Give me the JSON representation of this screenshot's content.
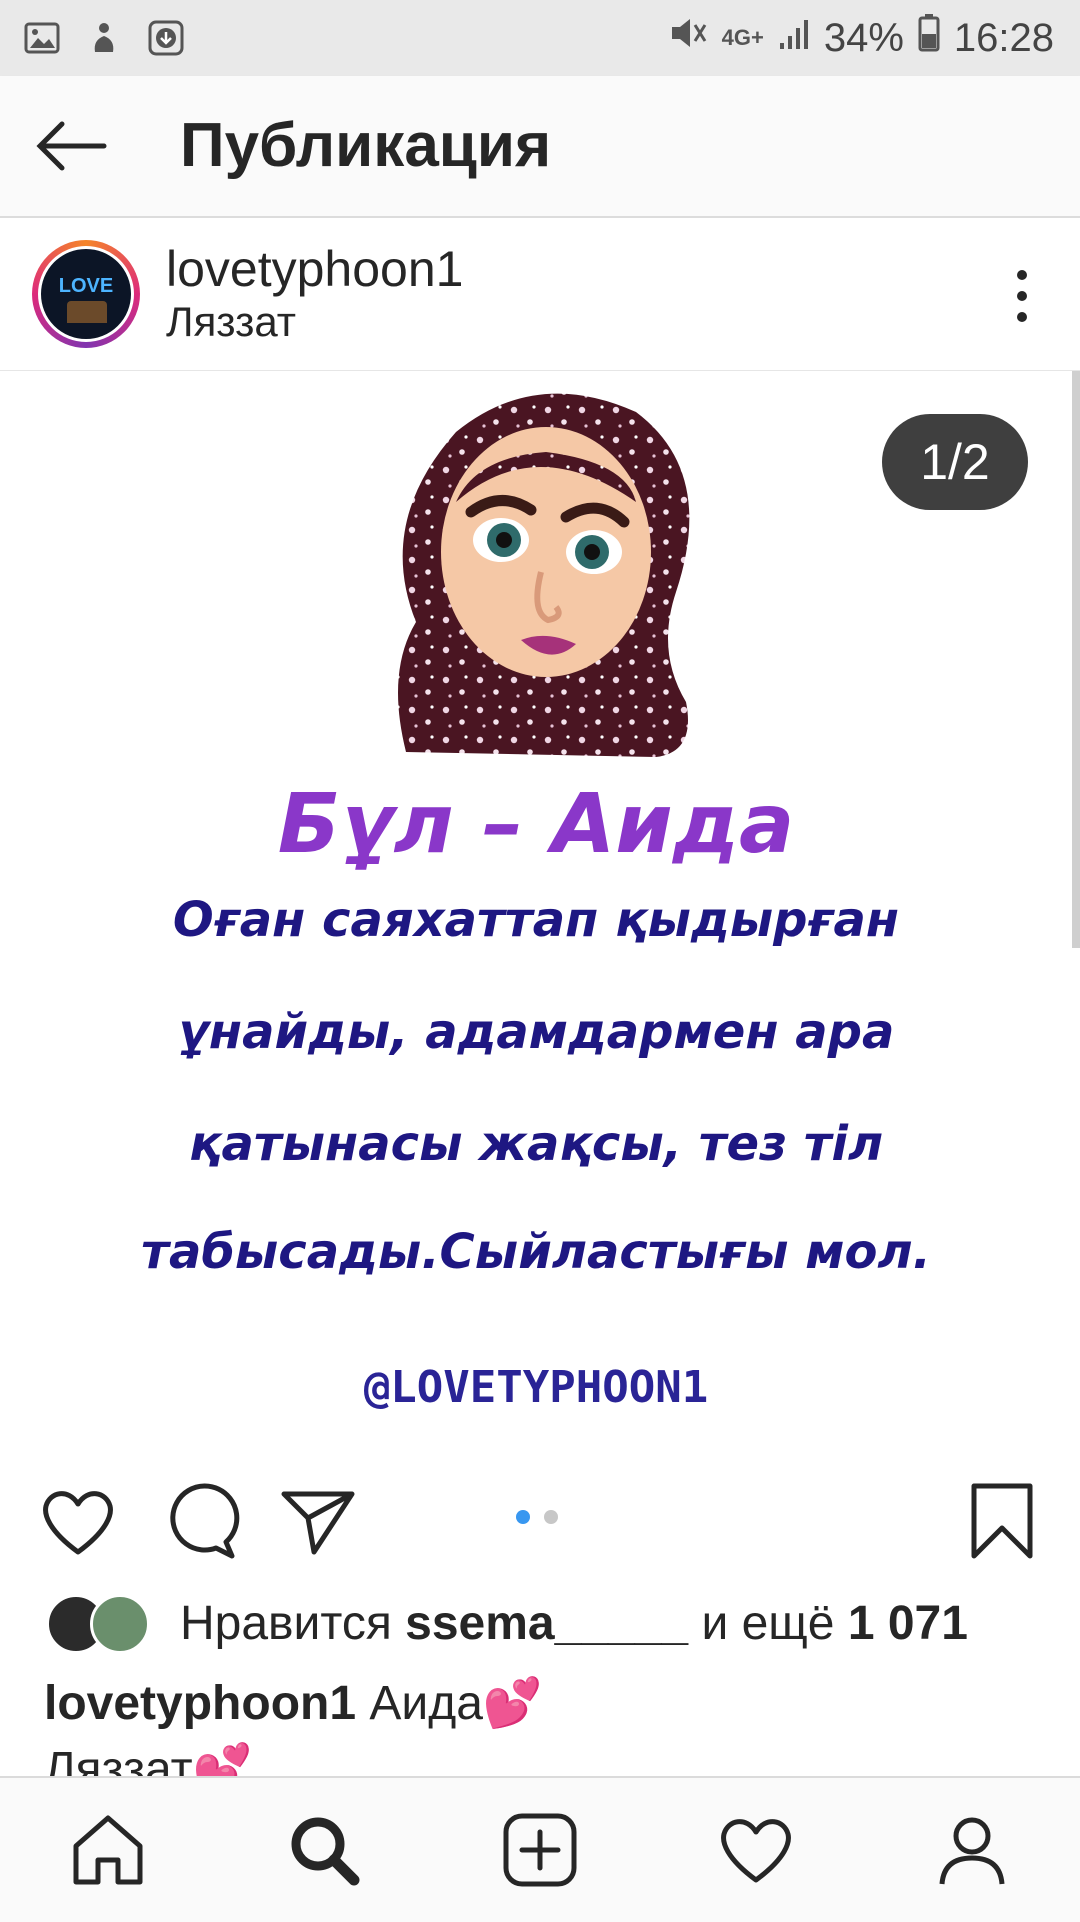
{
  "status_bar": {
    "network": "4G+",
    "battery": "34%",
    "time": "16:28"
  },
  "header": {
    "title": "Публикация"
  },
  "post": {
    "username": "lovetyphoon1",
    "location": "Ляззат",
    "avatar_text": "LOVE",
    "counter": "1/2",
    "image_text": {
      "title": "Бұл – Аида",
      "lines": [
        "Оған саяхаттап қыдырған",
        "ұнайды, адамдармен ара",
        "қатынасы жақсы, тез тіл",
        "табысады.Сыйластығы мол."
      ],
      "handle": "@LOVETYPHOON1"
    },
    "likes": {
      "prefix": "Нравится",
      "user": "ssema_____",
      "middle": "и ещё",
      "count": "1 071"
    },
    "caption": {
      "user": "lovetyphoon1",
      "text": "Аида💕",
      "second_line": "Ляззат💕"
    },
    "carousel": {
      "pages": 2,
      "active": 1
    }
  },
  "colors": {
    "accent_blue": "#3897f0",
    "title_purple": "#8a37c9",
    "text_navy": "#1e1782"
  },
  "icons": {
    "back": "arrow-left-icon",
    "more": "more-vertical-icon",
    "like": "heart-icon",
    "comment": "comment-icon",
    "share": "send-icon",
    "save": "bookmark-icon",
    "nav_home": "home-icon",
    "nav_search": "search-icon",
    "nav_add": "add-icon",
    "nav_activity": "heart-icon",
    "nav_profile": "profile-icon"
  }
}
